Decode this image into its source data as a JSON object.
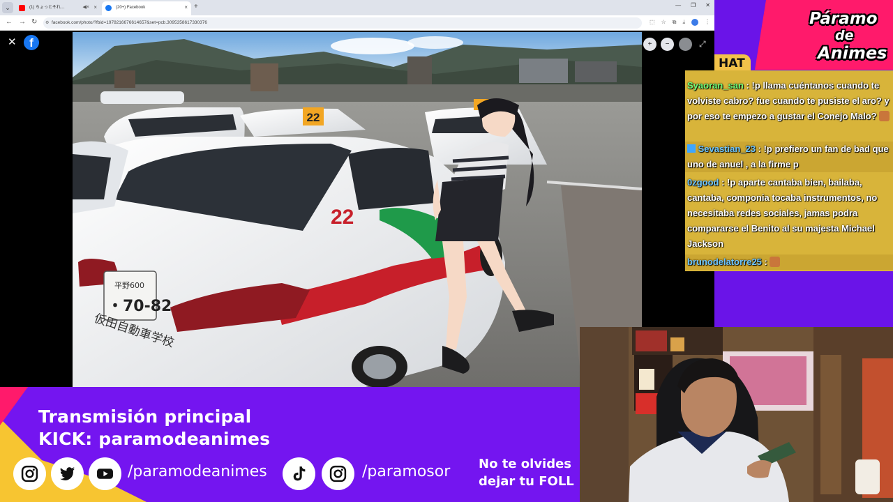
{
  "browser": {
    "tabs": [
      {
        "label": "(1) ちょっとそれ…",
        "active": false,
        "favicon_color": "#ff0000"
      },
      {
        "label": "(20+) Facebook",
        "active": true,
        "favicon_color": "#1877f2"
      }
    ],
    "url": "facebook.com/photo/?fbid=1978216676614657&set=pcb.3095358617330376",
    "nav": {
      "back": "←",
      "forward": "→",
      "reload": "↻"
    },
    "new_tab": "+",
    "window_controls": {
      "minimize": "—",
      "maximize": "❐",
      "close": "✕"
    },
    "tab_close": "×",
    "tab_mute": "◀×"
  },
  "viewer": {
    "close": "✕",
    "fb_logo": "f",
    "zoom_in": "+",
    "zoom_out": "−",
    "expand": "⤢"
  },
  "photo": {
    "car_number": "22",
    "plate_line1": "平野600",
    "plate_line2": "・70-82",
    "school_text": "仮田自動車学校"
  },
  "banner": {
    "line1": "Transmisión principal",
    "line2": "KICK: paramodeanimes",
    "handle1": "/paramodeanimes",
    "handle2": "/paramosor",
    "follow_line1": "No te olvides",
    "follow_line2": "dejar tu FOLL"
  },
  "logo": {
    "line1": "Páramo",
    "line2": "de",
    "line3": "Animes"
  },
  "chat": {
    "tab_label": "HAT",
    "messages": [
      {
        "user": "Syaoran_san",
        "text": " : !p llama cuéntanos cuando te volviste cabro? fue cuando te pusiste el aro? y por eso te empezo a gustar el Conejo Malo?"
      },
      {
        "user": "Sevastian_23",
        "text": " : !p prefiero un fan de bad que uno de anuel , a la firme p"
      },
      {
        "user": "0zgood",
        "text": " : !p aparte cantaba bien, bailaba, cantaba, componia tocaba instrumentos, no necesitaba redes sociales, jamas podra compararse el Benito al su majesta Michael Jackson"
      },
      {
        "user": "brunodelatorre25",
        "text": " : "
      }
    ]
  },
  "colors": {
    "banner_purple": "#6a14e8",
    "logo_pink": "#ff1a6b",
    "chat_gold": "#d8b43a",
    "fb_blue": "#1877f2"
  }
}
